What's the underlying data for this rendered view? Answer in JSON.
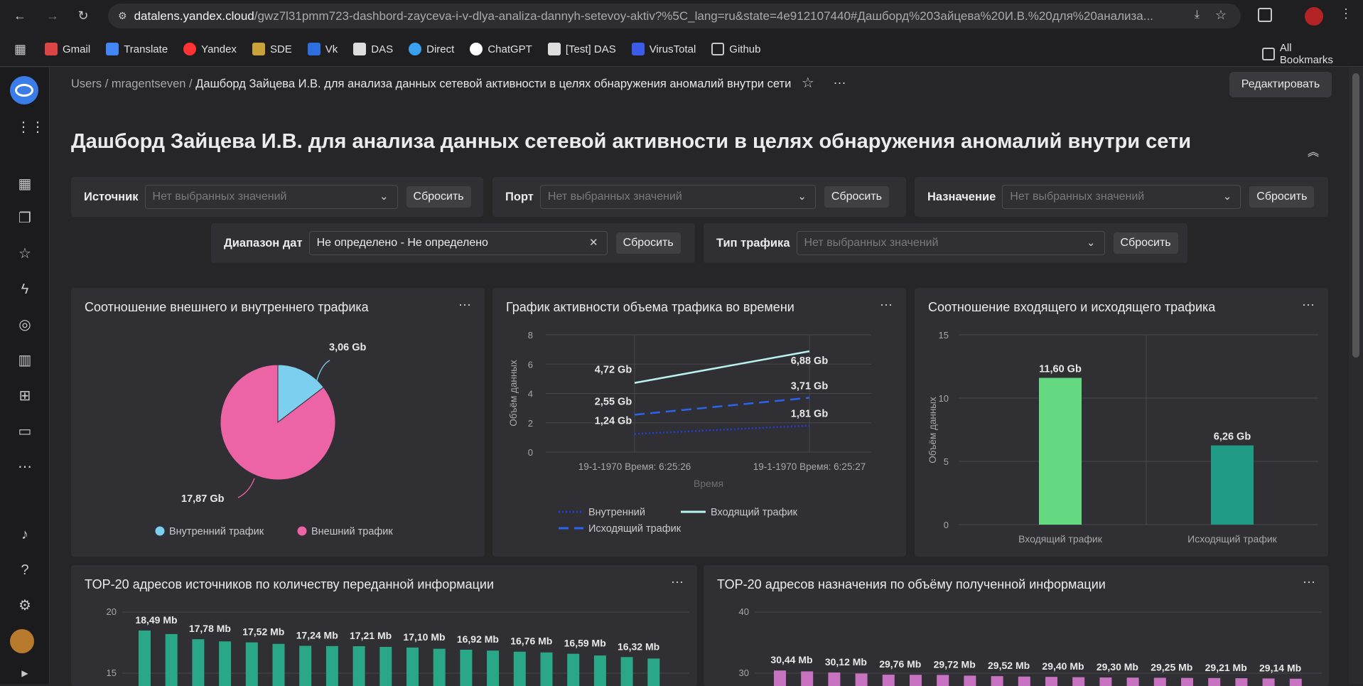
{
  "browser": {
    "url_host": "datalens.yandex.cloud",
    "url_rest": "/gwz7l31pmm723-dashbord-zayceva-i-v-dlya-analiza-dannyh-setevoy-aktiv?%5C_lang=ru&state=4e912107440#Дашборд%20Зайцева%20И.В.%20для%20анализа...",
    "bookmarks": [
      "Gmail",
      "Translate",
      "Yandex",
      "SDE",
      "Vk",
      "DAS",
      "Direct",
      "ChatGPT",
      "[Test] DAS",
      "VirusTotal",
      "Github"
    ],
    "all_bookmarks": "All Bookmarks"
  },
  "breadcrumb": {
    "users": "Users",
    "sep1": "/",
    "owner": "mragentseven",
    "sep2": "/",
    "current": "Дашборд Зайцева И.В. для анализа данных сетевой активности в целях обнаружения аномалий внутри сети"
  },
  "edit_button": "Редактировать",
  "title": "Дашборд Зайцева И.В. для анализа данных сетевой активности в целях обнаружения аномалий внутри сети",
  "filters": {
    "reset": "Сбросить",
    "source": {
      "label": "Источник",
      "placeholder": "Нет выбранных значений"
    },
    "port": {
      "label": "Порт",
      "placeholder": "Нет выбранных значений"
    },
    "dest": {
      "label": "Назначение",
      "placeholder": "Нет выбранных значений"
    },
    "dates": {
      "label": "Диапазон дат",
      "value": "Не определено - Не определено"
    },
    "traffic": {
      "label": "Тип трафика",
      "placeholder": "Нет выбранных значений"
    }
  },
  "colors": {
    "pie_internal": "#7ccfef",
    "pie_external": "#ec64a6",
    "bar_in": "#65d882",
    "bar_out": "#1f9a84",
    "top_src": "#2aa787",
    "top_dst": "#c873c2"
  },
  "chart_data": [
    {
      "type": "pie",
      "title": "Соотношение внешнего и внутреннего трафика",
      "slices": [
        {
          "name": "Внутренний трафик",
          "value": 3.06,
          "label": "3,06 Gb"
        },
        {
          "name": "Внешний трафик",
          "value": 17.87,
          "label": "17,87 Gb"
        }
      ],
      "legend": "bottom"
    },
    {
      "type": "line",
      "title": "График активности объема трафика во времени",
      "xlabel": "Время",
      "ylabel": "Объём данных",
      "ylim": [
        0,
        8
      ],
      "yticks": [
        "0",
        "2",
        "4",
        "6",
        "8"
      ],
      "categories": [
        "19-1-1970 Время: 6:25:26",
        "19-1-1970 Время: 6:25:27"
      ],
      "series": [
        {
          "name": "Внутренний",
          "values": [
            1.24,
            1.81
          ],
          "labels": [
            "1,24 Gb",
            "1,81 Gb"
          ],
          "color": "#1e40d8",
          "style": "dotted"
        },
        {
          "name": "Входящий трафик",
          "values": [
            4.72,
            6.88
          ],
          "labels": [
            "4,72 Gb",
            "6,88 Gb"
          ],
          "color": "#b9f3f0",
          "style": "solid"
        },
        {
          "name": "Исходящий трафик",
          "values": [
            2.55,
            3.71
          ],
          "labels": [
            "2,55 Gb",
            "3,71 Gb"
          ],
          "color": "#2a63ee",
          "style": "dashed"
        }
      ],
      "grid": true,
      "legend": "bottom"
    },
    {
      "type": "bar",
      "title": "Соотношение входящего и исходящего трафика",
      "ylabel": "Объём данных",
      "ylim": [
        0,
        15
      ],
      "yticks": [
        "0",
        "5",
        "10",
        "15"
      ],
      "categories": [
        "Входящий трафик",
        "Исходящий трафик"
      ],
      "values": [
        11.6,
        6.26
      ],
      "labels": [
        "11,60 Gb",
        "6,26 Gb"
      ]
    },
    {
      "type": "bar",
      "title": "TOP-20 адресов источников по количеству переданной информации",
      "ylim": [
        0,
        20
      ],
      "yticks": [
        "15",
        "20"
      ],
      "values": [
        18.49,
        18.2,
        17.78,
        17.6,
        17.52,
        17.4,
        17.24,
        17.22,
        17.21,
        17.15,
        17.1,
        17.0,
        16.92,
        16.85,
        16.76,
        16.7,
        16.59,
        16.45,
        16.32,
        16.2
      ],
      "labels": [
        "18,49 Mb",
        "",
        "17,78 Mb",
        "",
        "17,52 Mb",
        "",
        "17,24 Mb",
        "",
        "17,21 Mb",
        "",
        "17,10 Mb",
        "",
        "16,92 Mb",
        "",
        "16,76 Mb",
        "",
        "16,59 Mb",
        "",
        "16,32 Mb",
        ""
      ]
    },
    {
      "type": "bar",
      "title": "TOP-20 адресов назначения по объёму полученной информации",
      "ylim": [
        20,
        40
      ],
      "yticks": [
        "30",
        "40"
      ],
      "values": [
        30.44,
        30.3,
        30.12,
        29.95,
        29.76,
        29.74,
        29.72,
        29.6,
        29.52,
        29.45,
        29.4,
        29.35,
        29.3,
        29.28,
        29.25,
        29.23,
        29.21,
        29.18,
        29.14,
        29.1
      ],
      "labels": [
        "30,44 Mb",
        "",
        "30,12 Mb",
        "",
        "29,76 Mb",
        "",
        "29,72 Mb",
        "",
        "29,52 Mb",
        "",
        "29,40 Mb",
        "",
        "29,30 Mb",
        "",
        "29,25 Mb",
        "",
        "29,21 Mb",
        "",
        "29,14 Mb",
        ""
      ]
    }
  ]
}
